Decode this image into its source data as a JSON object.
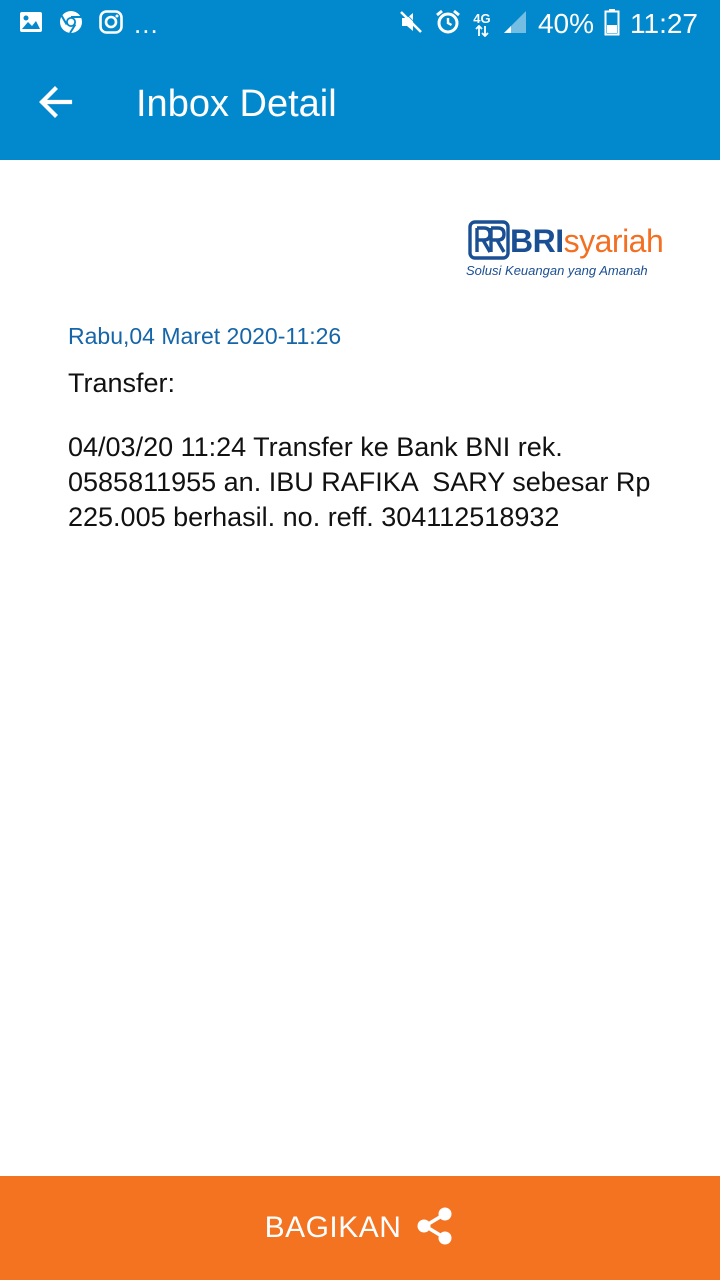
{
  "status_bar": {
    "left_icons": [
      "gallery-icon",
      "chrome-icon",
      "instagram-icon"
    ],
    "more_indicator": "...",
    "right_icons": [
      "mute-icon",
      "alarm-icon",
      "network-4g-icon",
      "signal-icon"
    ],
    "network_label": "4G",
    "battery_percent": "40%",
    "battery_level": 0.4,
    "time": "11:27"
  },
  "app_bar": {
    "back_icon": "arrow-left-icon",
    "title": "Inbox Detail"
  },
  "logo": {
    "brand_bold": "BRI",
    "brand_light": "syariah",
    "tagline": "Solusi Keuangan yang Amanah"
  },
  "message": {
    "date": "Rabu,04 Maret 2020-11:26",
    "subject": "Transfer:",
    "body": "04/03/20 11:24 Transfer ke Bank BNI rek. 0585811955 an. IBU RAFIKA  SARY sebesar Rp 225.005 berhasil. no. reff. 304112518932"
  },
  "share_button": {
    "label": "BAGIKAN",
    "icon": "share-icon"
  },
  "colors": {
    "primary": "#0288cc",
    "accent": "#f47321",
    "brand_blue": "#1b4f93",
    "brand_orange": "#f36f21",
    "date_text": "#1565a8"
  }
}
